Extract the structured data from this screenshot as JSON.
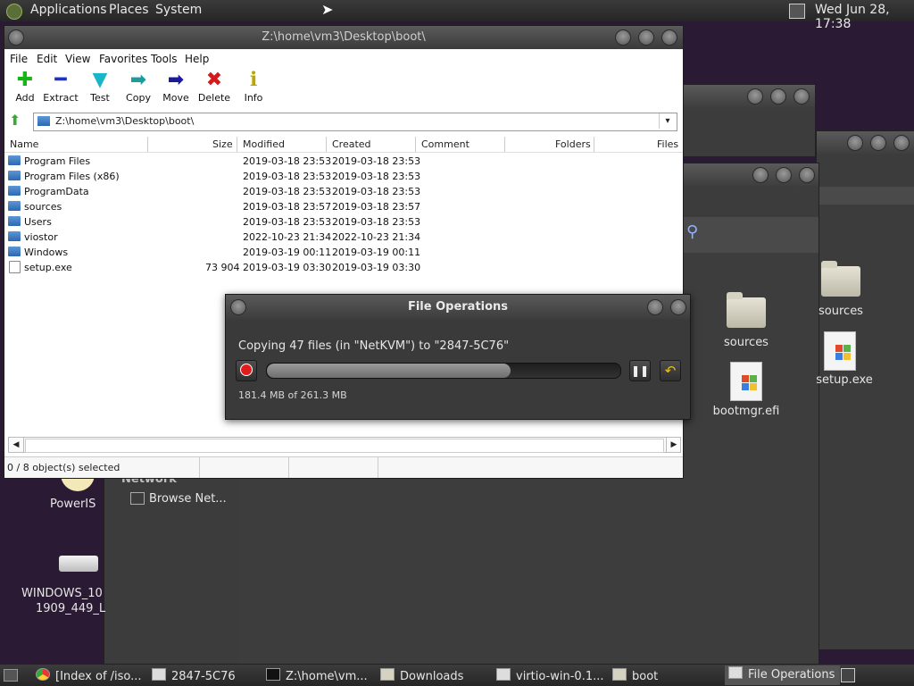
{
  "top_panel": {
    "menus": [
      "Applications",
      "Places",
      "System"
    ],
    "clock": "Wed Jun 28, 17:38"
  },
  "desktop": {
    "icons": [
      {
        "label": "sources"
      },
      {
        "label": "setup.exe"
      },
      {
        "label": "sources"
      },
      {
        "label": "bootmgr.efi"
      },
      {
        "label": "PowerIS"
      },
      {
        "label": "WINDOWS_10"
      },
      {
        "label": "1909_449_L"
      }
    ],
    "sidebar": {
      "section": "Network",
      "item": "Browse Net..."
    }
  },
  "file_manager": {
    "title": "Z:\\home\\vm3\\Desktop\\boot\\",
    "menu": [
      "File",
      "Edit",
      "View",
      "Favorites",
      "Tools",
      "Help"
    ],
    "toolbar": [
      {
        "label": "Add",
        "glyph": "✚",
        "icon": "add-icon",
        "color": "#17b317"
      },
      {
        "label": "Extract",
        "glyph": "━",
        "icon": "extract-icon",
        "color": "#1a2fd6"
      },
      {
        "label": "Test",
        "glyph": "▼",
        "icon": "test-icon",
        "color": "#19b6c9"
      },
      {
        "label": "Copy",
        "glyph": "➡",
        "icon": "copy-icon",
        "color": "#1c9c9c"
      },
      {
        "label": "Move",
        "glyph": "➡",
        "icon": "move-icon",
        "color": "#1a1a9c"
      },
      {
        "label": "Delete",
        "glyph": "✖",
        "icon": "delete-icon",
        "color": "#d41a1a"
      },
      {
        "label": "Info",
        "glyph": "ℹ",
        "icon": "info-icon",
        "color": "#b8a800"
      }
    ],
    "address": "Z:\\home\\vm3\\Desktop\\boot\\",
    "columns": [
      "Name",
      "Size",
      "Modified",
      "Created",
      "Comment",
      "Folders",
      "Files"
    ],
    "rows": [
      {
        "name": "Program Files",
        "size": "",
        "modified": "2019-03-18 23:53",
        "created": "2019-03-18 23:53",
        "type": "folder"
      },
      {
        "name": "Program Files (x86)",
        "size": "",
        "modified": "2019-03-18 23:53",
        "created": "2019-03-18 23:53",
        "type": "folder"
      },
      {
        "name": "ProgramData",
        "size": "",
        "modified": "2019-03-18 23:53",
        "created": "2019-03-18 23:53",
        "type": "folder"
      },
      {
        "name": "sources",
        "size": "",
        "modified": "2019-03-18 23:57",
        "created": "2019-03-18 23:57",
        "type": "folder"
      },
      {
        "name": "Users",
        "size": "",
        "modified": "2019-03-18 23:53",
        "created": "2019-03-18 23:53",
        "type": "folder"
      },
      {
        "name": "viostor",
        "size": "",
        "modified": "2022-10-23 21:34",
        "created": "2022-10-23 21:34",
        "type": "folder"
      },
      {
        "name": "Windows",
        "size": "",
        "modified": "2019-03-19 00:11",
        "created": "2019-03-19 00:11",
        "type": "folder"
      },
      {
        "name": "setup.exe",
        "size": "73 904",
        "modified": "2019-03-19 03:30",
        "created": "2019-03-19 03:30",
        "type": "file"
      }
    ],
    "status": "0 / 8 object(s) selected"
  },
  "file_operations": {
    "title": "File Operations",
    "message": "Copying 47 files (in \"NetKVM\") to \"2847-5C76\"",
    "progress_fraction": 0.69,
    "size_text": "181.4 MB of 261.3 MB"
  },
  "taskbar": {
    "items": [
      {
        "label": "[Index of /iso...",
        "icon": "browser-icon"
      },
      {
        "label": "2847-5C76",
        "icon": "drive-icon"
      },
      {
        "label": "Z:\\home\\vm...",
        "icon": "7zip-icon"
      },
      {
        "label": "Downloads",
        "icon": "folder-icon"
      },
      {
        "label": "virtio-win-0.1...",
        "icon": "drive-icon"
      },
      {
        "label": "boot",
        "icon": "folder-icon"
      },
      {
        "label": "File Operations",
        "icon": "window-icon"
      }
    ]
  }
}
